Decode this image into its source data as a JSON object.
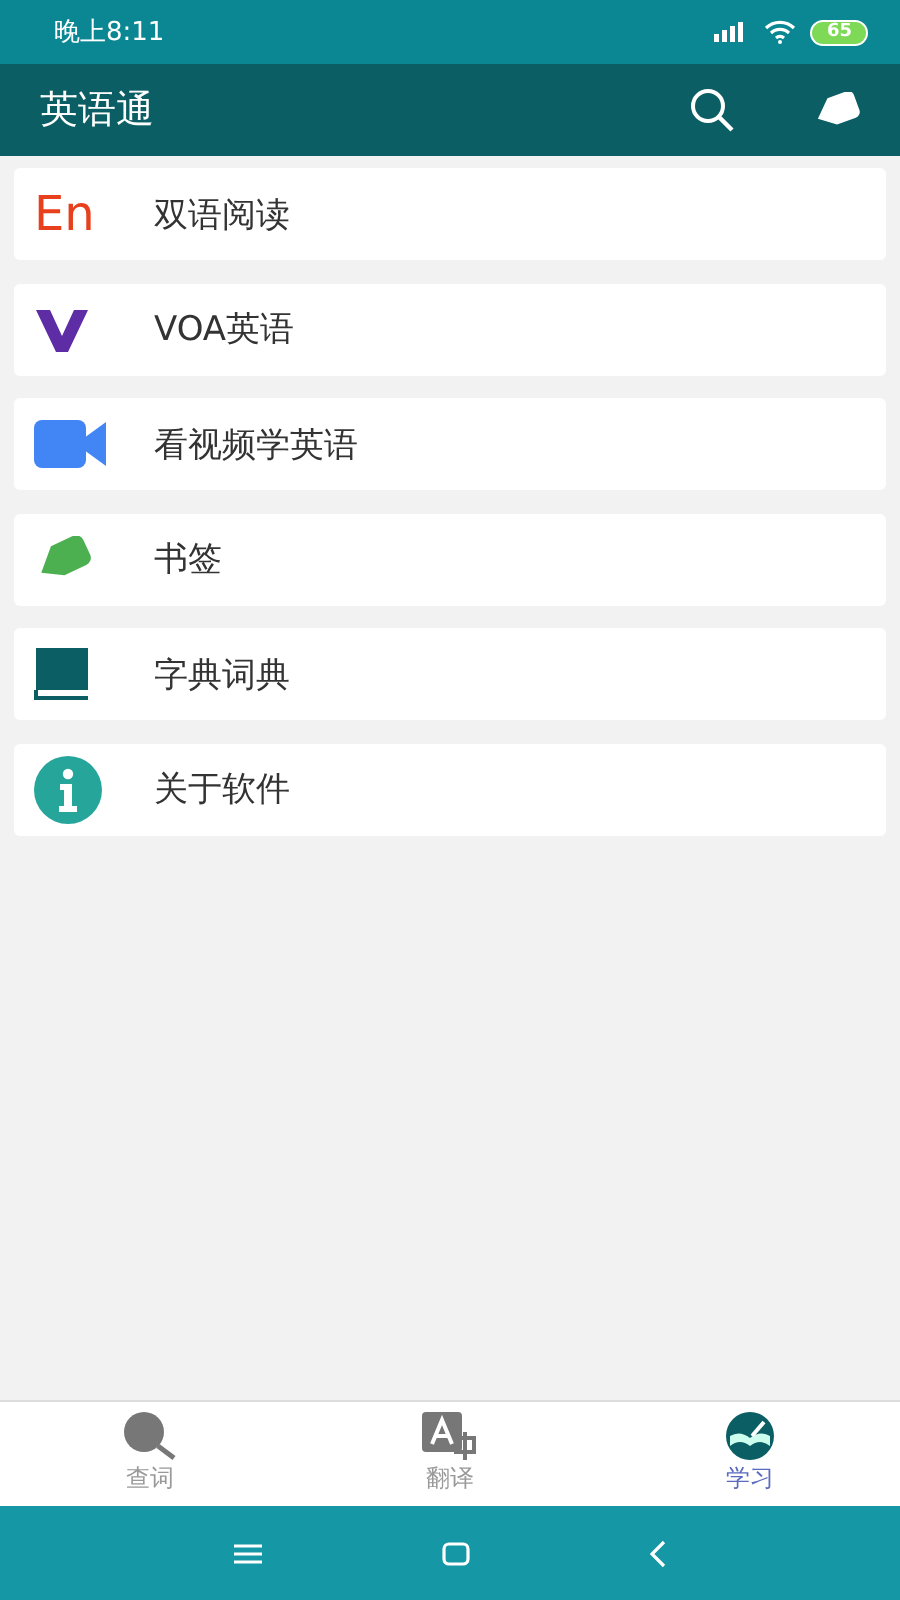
{
  "status_bar": {
    "time": "晚上8:11",
    "battery": "65"
  },
  "app_bar": {
    "title": "英语通"
  },
  "menu": [
    {
      "kind": "en",
      "icon_text": "En",
      "label": "双语阅读"
    },
    {
      "kind": "voa",
      "label": "VOA英语"
    },
    {
      "kind": "video",
      "label": "看视频学英语"
    },
    {
      "kind": "bookmark",
      "label": "书签"
    },
    {
      "kind": "dictionary",
      "label": "字典词典"
    },
    {
      "kind": "info",
      "label": "关于软件"
    }
  ],
  "bottom_tabs": [
    {
      "kind": "lookup",
      "label": "查词",
      "selected": false
    },
    {
      "kind": "translate",
      "label": "翻译",
      "selected": false
    },
    {
      "kind": "study",
      "label": "学习",
      "selected": true
    }
  ]
}
